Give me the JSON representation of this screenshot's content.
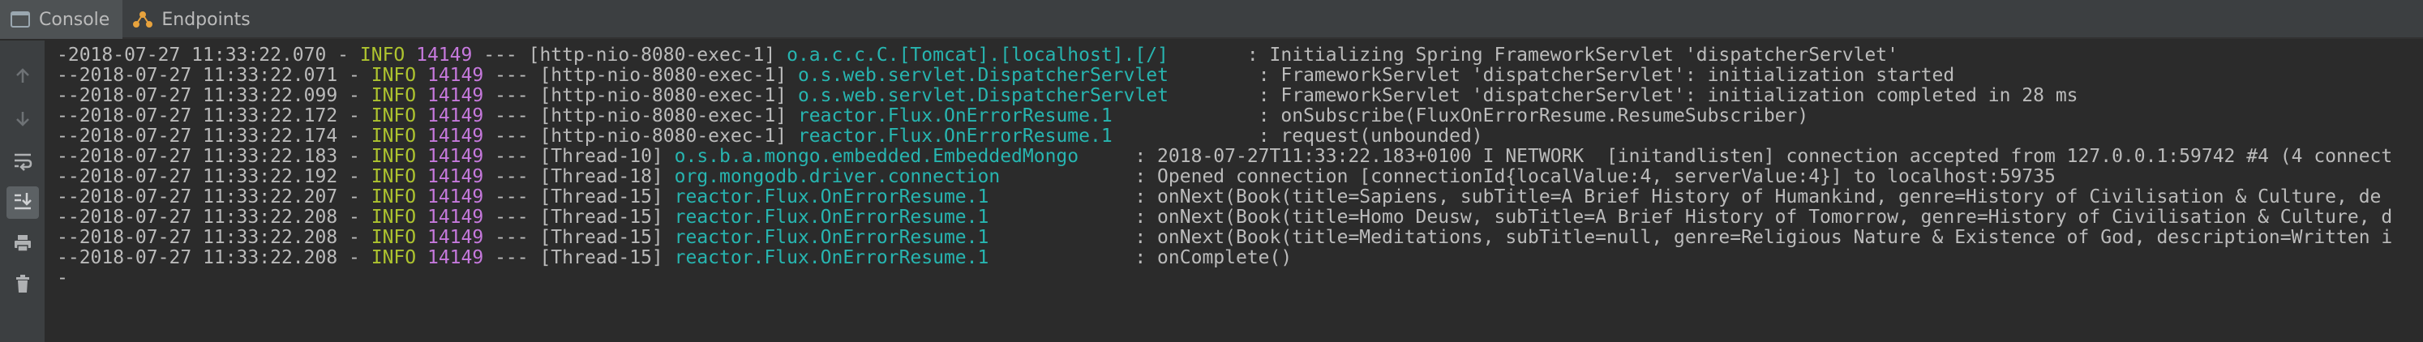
{
  "tabs": [
    {
      "label": "Console",
      "icon": "console-icon"
    },
    {
      "label": "Endpoints",
      "icon": "endpoints-icon"
    }
  ],
  "toolbar": [
    {
      "name": "scroll-up-icon"
    },
    {
      "name": "scroll-down-icon"
    },
    {
      "name": "soft-wrap-icon"
    },
    {
      "name": "scroll-to-end-icon"
    },
    {
      "name": "print-icon"
    },
    {
      "name": "clear-all-icon"
    }
  ],
  "colors": {
    "level": "#aec42f",
    "pid": "#c679dd",
    "logger": "#27b5b0",
    "text": "#bbbbbb"
  },
  "log_lines": [
    {
      "prefix": "-2018-07-27 11:33:22.070 - ",
      "level": "INFO",
      "pid": " 14149",
      "thread": " --- [http-nio-8080-exec-1] ",
      "logger": "o.a.c.c.C.[Tomcat].[localhost].[/]      ",
      "message": " : Initializing Spring FrameworkServlet 'dispatcherServlet'"
    },
    {
      "prefix": "--2018-07-27 11:33:22.071 - ",
      "level": "INFO",
      "pid": " 14149",
      "thread": " --- [http-nio-8080-exec-1] ",
      "logger": "o.s.web.servlet.DispatcherServlet       ",
      "message": " : FrameworkServlet 'dispatcherServlet': initialization started"
    },
    {
      "prefix": "--2018-07-27 11:33:22.099 - ",
      "level": "INFO",
      "pid": " 14149",
      "thread": " --- [http-nio-8080-exec-1] ",
      "logger": "o.s.web.servlet.DispatcherServlet       ",
      "message": " : FrameworkServlet 'dispatcherServlet': initialization completed in 28 ms"
    },
    {
      "prefix": "--2018-07-27 11:33:22.172 - ",
      "level": "INFO",
      "pid": " 14149",
      "thread": " --- [http-nio-8080-exec-1] ",
      "logger": "reactor.Flux.OnErrorResume.1            ",
      "message": " : onSubscribe(FluxOnErrorResume.ResumeSubscriber)"
    },
    {
      "prefix": "--2018-07-27 11:33:22.174 - ",
      "level": "INFO",
      "pid": " 14149",
      "thread": " --- [http-nio-8080-exec-1] ",
      "logger": "reactor.Flux.OnErrorResume.1            ",
      "message": " : request(unbounded)"
    },
    {
      "prefix": "--2018-07-27 11:33:22.183 - ",
      "level": "INFO",
      "pid": " 14149",
      "thread": " --- [Thread-10] ",
      "logger": "o.s.b.a.mongo.embedded.EmbeddedMongo    ",
      "message": " : 2018-07-27T11:33:22.183+0100 I NETWORK  [initandlisten] connection accepted from 127.0.0.1:59742 #4 (4 connect"
    },
    {
      "prefix": "--2018-07-27 11:33:22.192 - ",
      "level": "INFO",
      "pid": " 14149",
      "thread": " --- [Thread-18] ",
      "logger": "org.mongodb.driver.connection           ",
      "message": " : Opened connection [connectionId{localValue:4, serverValue:4}] to localhost:59735"
    },
    {
      "prefix": "--2018-07-27 11:33:22.207 - ",
      "level": "INFO",
      "pid": " 14149",
      "thread": " --- [Thread-15] ",
      "logger": "reactor.Flux.OnErrorResume.1            ",
      "message": " : onNext(Book(title=Sapiens, subTitle=A Brief History of Humankind, genre=History of Civilisation & Culture, de"
    },
    {
      "prefix": "--2018-07-27 11:33:22.208 - ",
      "level": "INFO",
      "pid": " 14149",
      "thread": " --- [Thread-15] ",
      "logger": "reactor.Flux.OnErrorResume.1            ",
      "message": " : onNext(Book(title=Homo Deusw, subTitle=A Brief History of Tomorrow, genre=History of Civilisation & Culture, d"
    },
    {
      "prefix": "--2018-07-27 11:33:22.208 - ",
      "level": "INFO",
      "pid": " 14149",
      "thread": " --- [Thread-15] ",
      "logger": "reactor.Flux.OnErrorResume.1            ",
      "message": " : onNext(Book(title=Meditations, subTitle=null, genre=Religious Nature & Existence of God, description=Written i"
    },
    {
      "prefix": "--2018-07-27 11:33:22.208 - ",
      "level": "INFO",
      "pid": " 14149",
      "thread": " --- [Thread-15] ",
      "logger": "reactor.Flux.OnErrorResume.1            ",
      "message": " : onComplete()"
    }
  ],
  "cursor_line": "-"
}
